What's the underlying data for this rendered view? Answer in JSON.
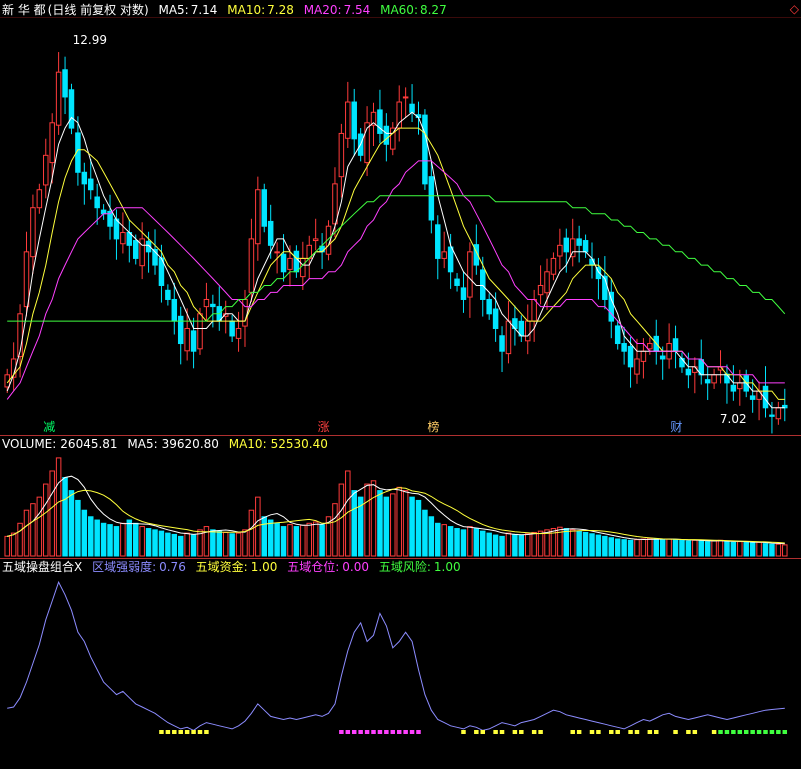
{
  "price_panel": {
    "stock_name": "新 华 都",
    "mode": "(日线 前复权 对数)",
    "ma5": {
      "label": "MA5:",
      "value": "7.14",
      "color": "#ffffff"
    },
    "ma10": {
      "label": "MA10:",
      "value": "7.28",
      "color": "#ffff3c"
    },
    "ma20": {
      "label": "MA20:",
      "value": "7.54",
      "color": "#ff40ff"
    },
    "ma60": {
      "label": "MA60:",
      "value": "8.27",
      "color": "#40ff40"
    },
    "high_label": "12.99",
    "low_label": "7.02",
    "events": [
      {
        "text": "减",
        "color": "#00ff66"
      },
      {
        "text": "涨",
        "color": "#ff4040"
      },
      {
        "text": "榜",
        "color": "#ffcc66"
      },
      {
        "text": "财",
        "color": "#6699ff"
      }
    ],
    "corner_icon": "◇"
  },
  "volume_panel": {
    "volume": {
      "label": "VOLUME:",
      "value": "26045.81",
      "color": "#ffffff"
    },
    "ma5": {
      "label": "MA5:",
      "value": "39620.80",
      "color": "#ffffff"
    },
    "ma10": {
      "label": "MA10:",
      "value": "52530.40",
      "color": "#ffff3c"
    }
  },
  "indicator_panel": {
    "name": {
      "label": "五域操盘组合X",
      "color": "#ffffff"
    },
    "strength": {
      "label": "区域强弱度:",
      "value": "0.76",
      "color": "#8c8cff"
    },
    "funds": {
      "label": "五域资金:",
      "value": "1.00",
      "color": "#ffff3c"
    },
    "position": {
      "label": "五域仓位:",
      "value": "0.00",
      "color": "#ff40ff"
    },
    "risk": {
      "label": "五域风险:",
      "value": "1.00",
      "color": "#40ff40"
    }
  },
  "chart_data": {
    "type": "candlestick",
    "price_range": [
      6.9,
      13.3
    ],
    "up_color": "#ff3b3b",
    "down_color": "#00e5ff",
    "close": [
      7.5,
      7.7,
      8.3,
      9.2,
      9.9,
      10.2,
      10.8,
      11.4,
      12.4,
      11.9,
      11.3,
      10.5,
      10.3,
      10.2,
      9.9,
      9.8,
      9.6,
      9.4,
      9.5,
      9.3,
      9.1,
      9.4,
      9.2,
      9.0,
      8.7,
      8.5,
      8.2,
      7.9,
      8.1,
      7.8,
      8.3,
      8.5,
      8.4,
      8.2,
      8.3,
      8.0,
      8.1,
      8.5,
      9.4,
      10.2,
      9.6,
      9.3,
      9.2,
      8.9,
      9.1,
      8.9,
      9.1,
      9.3,
      9.4,
      9.2,
      9.6,
      10.3,
      11.2,
      11.8,
      11.1,
      10.8,
      11.4,
      11.6,
      11.2,
      11.0,
      11.3,
      11.8,
      11.9,
      11.6,
      11.5,
      10.3,
      9.7,
      9.1,
      9.2,
      8.9,
      8.7,
      8.5,
      9.2,
      9.0,
      8.5,
      8.3,
      8.1,
      7.8,
      8.2,
      8.1,
      8.0,
      8.2,
      8.5,
      8.7,
      8.9,
      9.1,
      9.3,
      9.2,
      9.4,
      9.3,
      9.2,
      9.0,
      8.8,
      8.5,
      8.2,
      7.9,
      7.8,
      7.6,
      7.7,
      7.8,
      7.9,
      7.8,
      7.7,
      7.9,
      7.8,
      7.6,
      7.5,
      7.6,
      7.5,
      7.4,
      7.5,
      7.6,
      7.4,
      7.3,
      7.4,
      7.3,
      7.2,
      7.3,
      7.1,
      7.0,
      7.1,
      7.1
    ],
    "ma5": [
      7.3,
      7.5,
      7.8,
      8.3,
      8.9,
      9.4,
      9.9,
      10.4,
      11.0,
      11.3,
      11.5,
      11.4,
      11.1,
      10.7,
      10.4,
      10.1,
      9.9,
      9.7,
      9.6,
      9.5,
      9.4,
      9.3,
      9.3,
      9.2,
      9.1,
      8.9,
      8.7,
      8.5,
      8.3,
      8.1,
      8.1,
      8.1,
      8.2,
      8.2,
      8.3,
      8.3,
      8.2,
      8.2,
      8.5,
      8.8,
      9.0,
      9.2,
      9.4,
      9.4,
      9.2,
      9.1,
      9.0,
      9.0,
      9.2,
      9.2,
      9.3,
      9.6,
      10.0,
      10.6,
      10.8,
      11.0,
      11.3,
      11.4,
      11.3,
      11.2,
      11.2,
      11.4,
      11.5,
      11.6,
      11.5,
      11.2,
      10.7,
      10.1,
      9.7,
      9.3,
      9.1,
      8.9,
      8.8,
      8.7,
      8.7,
      8.6,
      8.5,
      8.3,
      8.2,
      8.1,
      8.0,
      8.0,
      8.1,
      8.3,
      8.5,
      8.7,
      8.9,
      9.0,
      9.2,
      9.2,
      9.2,
      9.1,
      8.9,
      8.8,
      8.5,
      8.3,
      8.0,
      7.9,
      7.8,
      7.8,
      7.8,
      7.8,
      7.8,
      7.8,
      7.8,
      7.7,
      7.6,
      7.6,
      7.5,
      7.5,
      7.5,
      7.5,
      7.5,
      7.4,
      7.4,
      7.4,
      7.3,
      7.3,
      7.2,
      7.1,
      7.1,
      7.1
    ],
    "ma10": [
      7.4,
      7.5,
      7.6,
      7.9,
      8.3,
      8.6,
      9.0,
      9.5,
      10.0,
      10.4,
      10.7,
      10.9,
      10.9,
      10.8,
      10.7,
      10.5,
      10.3,
      10.1,
      9.9,
      9.7,
      9.6,
      9.5,
      9.4,
      9.3,
      9.2,
      9.0,
      8.9,
      8.7,
      8.6,
      8.4,
      8.3,
      8.2,
      8.2,
      8.2,
      8.2,
      8.2,
      8.2,
      8.2,
      8.4,
      8.6,
      8.8,
      9.0,
      9.1,
      9.2,
      9.2,
      9.1,
      9.1,
      9.1,
      9.2,
      9.2,
      9.3,
      9.4,
      9.6,
      9.9,
      10.2,
      10.4,
      10.6,
      10.8,
      11.0,
      11.1,
      11.2,
      11.3,
      11.3,
      11.3,
      11.3,
      11.2,
      11.0,
      10.8,
      10.5,
      10.2,
      9.9,
      9.6,
      9.4,
      9.2,
      9.0,
      8.8,
      8.7,
      8.6,
      8.5,
      8.4,
      8.3,
      8.2,
      8.2,
      8.2,
      8.3,
      8.4,
      8.5,
      8.6,
      8.8,
      8.9,
      9.0,
      9.0,
      9.0,
      8.9,
      8.8,
      8.6,
      8.5,
      8.3,
      8.2,
      8.1,
      8.0,
      7.9,
      7.8,
      7.8,
      7.8,
      7.8,
      7.7,
      7.7,
      7.7,
      7.6,
      7.6,
      7.6,
      7.5,
      7.5,
      7.5,
      7.4,
      7.4,
      7.3,
      7.3,
      7.3,
      7.2,
      7.2
    ],
    "ma20": [
      7.2,
      7.3,
      7.4,
      7.6,
      7.8,
      8.0,
      8.3,
      8.5,
      8.8,
      9.0,
      9.2,
      9.4,
      9.5,
      9.6,
      9.7,
      9.8,
      9.8,
      9.9,
      9.9,
      9.9,
      9.9,
      9.9,
      9.8,
      9.7,
      9.6,
      9.5,
      9.4,
      9.3,
      9.2,
      9.1,
      9.0,
      8.9,
      8.8,
      8.7,
      8.6,
      8.5,
      8.5,
      8.4,
      8.4,
      8.5,
      8.5,
      8.6,
      8.6,
      8.7,
      8.7,
      8.7,
      8.7,
      8.8,
      8.8,
      8.8,
      8.9,
      8.9,
      9.0,
      9.2,
      9.3,
      9.4,
      9.6,
      9.7,
      9.9,
      10.0,
      10.2,
      10.3,
      10.5,
      10.6,
      10.7,
      10.7,
      10.7,
      10.6,
      10.5,
      10.4,
      10.3,
      10.1,
      10.0,
      9.8,
      9.6,
      9.4,
      9.2,
      9.0,
      8.9,
      8.7,
      8.6,
      8.5,
      8.5,
      8.4,
      8.4,
      8.4,
      8.4,
      8.5,
      8.5,
      8.5,
      8.5,
      8.5,
      8.4,
      8.4,
      8.3,
      8.2,
      8.1,
      8.0,
      7.9,
      7.9,
      7.8,
      7.8,
      7.8,
      7.8,
      7.8,
      7.8,
      7.7,
      7.7,
      7.7,
      7.6,
      7.6,
      7.6,
      7.6,
      7.5,
      7.5,
      7.5,
      7.5,
      7.4,
      7.4,
      7.4,
      7.4,
      7.4
    ],
    "ma60": [
      8.2,
      8.2,
      8.2,
      8.2,
      8.2,
      8.2,
      8.2,
      8.2,
      8.2,
      8.2,
      8.2,
      8.2,
      8.2,
      8.2,
      8.2,
      8.2,
      8.2,
      8.2,
      8.2,
      8.2,
      8.2,
      8.2,
      8.2,
      8.2,
      8.2,
      8.2,
      8.2,
      8.2,
      8.2,
      8.2,
      8.2,
      8.2,
      8.3,
      8.3,
      8.4,
      8.4,
      8.5,
      8.5,
      8.6,
      8.6,
      8.7,
      8.7,
      8.8,
      8.8,
      8.9,
      8.9,
      9.0,
      9.1,
      9.2,
      9.3,
      9.4,
      9.5,
      9.6,
      9.7,
      9.8,
      9.9,
      10.0,
      10.0,
      10.1,
      10.1,
      10.1,
      10.1,
      10.1,
      10.1,
      10.1,
      10.1,
      10.1,
      10.1,
      10.1,
      10.1,
      10.1,
      10.1,
      10.1,
      10.1,
      10.1,
      10.1,
      10.0,
      10.0,
      10.0,
      10.0,
      10.0,
      10.0,
      10.0,
      10.0,
      10.0,
      10.0,
      10.0,
      10.0,
      9.9,
      9.9,
      9.9,
      9.8,
      9.8,
      9.8,
      9.7,
      9.7,
      9.6,
      9.6,
      9.5,
      9.5,
      9.4,
      9.4,
      9.3,
      9.3,
      9.2,
      9.2,
      9.1,
      9.1,
      9.0,
      9.0,
      8.9,
      8.9,
      8.8,
      8.8,
      8.7,
      8.7,
      8.6,
      8.6,
      8.5,
      8.5,
      8.4,
      8.3
    ],
    "volume": [
      30,
      35,
      50,
      70,
      80,
      90,
      110,
      130,
      150,
      120,
      100,
      85,
      70,
      60,
      55,
      50,
      48,
      45,
      50,
      55,
      50,
      45,
      42,
      40,
      38,
      35,
      33,
      30,
      35,
      32,
      40,
      45,
      40,
      38,
      36,
      34,
      35,
      40,
      70,
      90,
      60,
      55,
      50,
      45,
      48,
      45,
      47,
      50,
      52,
      48,
      60,
      80,
      110,
      130,
      100,
      90,
      110,
      115,
      100,
      90,
      95,
      105,
      100,
      90,
      85,
      70,
      60,
      50,
      48,
      45,
      42,
      40,
      45,
      42,
      38,
      35,
      32,
      30,
      35,
      33,
      32,
      34,
      36,
      38,
      40,
      42,
      44,
      42,
      40,
      38,
      36,
      34,
      32,
      30,
      28,
      26,
      25,
      24,
      25,
      26,
      27,
      26,
      25,
      26,
      25,
      24,
      23,
      24,
      23,
      22,
      23,
      24,
      22,
      21,
      22,
      21,
      20,
      21,
      19,
      18,
      18,
      17
    ],
    "strength": [
      0.76,
      0.8,
      1.1,
      1.6,
      2.2,
      2.8,
      3.6,
      4.2,
      4.8,
      4.4,
      3.9,
      3.2,
      2.9,
      2.4,
      2.0,
      1.6,
      1.4,
      1.2,
      1.3,
      1.1,
      0.9,
      0.8,
      0.7,
      0.6,
      0.45,
      0.3,
      0.2,
      0.1,
      0.15,
      0.05,
      0.2,
      0.3,
      0.25,
      0.2,
      0.15,
      0.1,
      0.2,
      0.35,
      0.6,
      0.9,
      0.7,
      0.5,
      0.45,
      0.4,
      0.45,
      0.4,
      0.45,
      0.5,
      0.55,
      0.5,
      0.6,
      0.9,
      1.8,
      2.6,
      3.2,
      3.5,
      2.9,
      3.1,
      3.8,
      3.4,
      2.7,
      2.9,
      3.2,
      2.9,
      2.0,
      1.2,
      0.7,
      0.4,
      0.3,
      0.2,
      0.15,
      0.1,
      0.2,
      0.15,
      0.05,
      0.1,
      0.2,
      0.3,
      0.25,
      0.2,
      0.3,
      0.35,
      0.4,
      0.5,
      0.6,
      0.7,
      0.65,
      0.55,
      0.5,
      0.45,
      0.4,
      0.35,
      0.3,
      0.25,
      0.2,
      0.15,
      0.1,
      0.2,
      0.3,
      0.4,
      0.35,
      0.45,
      0.55,
      0.6,
      0.5,
      0.45,
      0.4,
      0.45,
      0.5,
      0.55,
      0.5,
      0.45,
      0.4,
      0.45,
      0.5,
      0.55,
      0.6,
      0.65,
      0.7,
      0.72,
      0.74,
      0.76
    ]
  }
}
